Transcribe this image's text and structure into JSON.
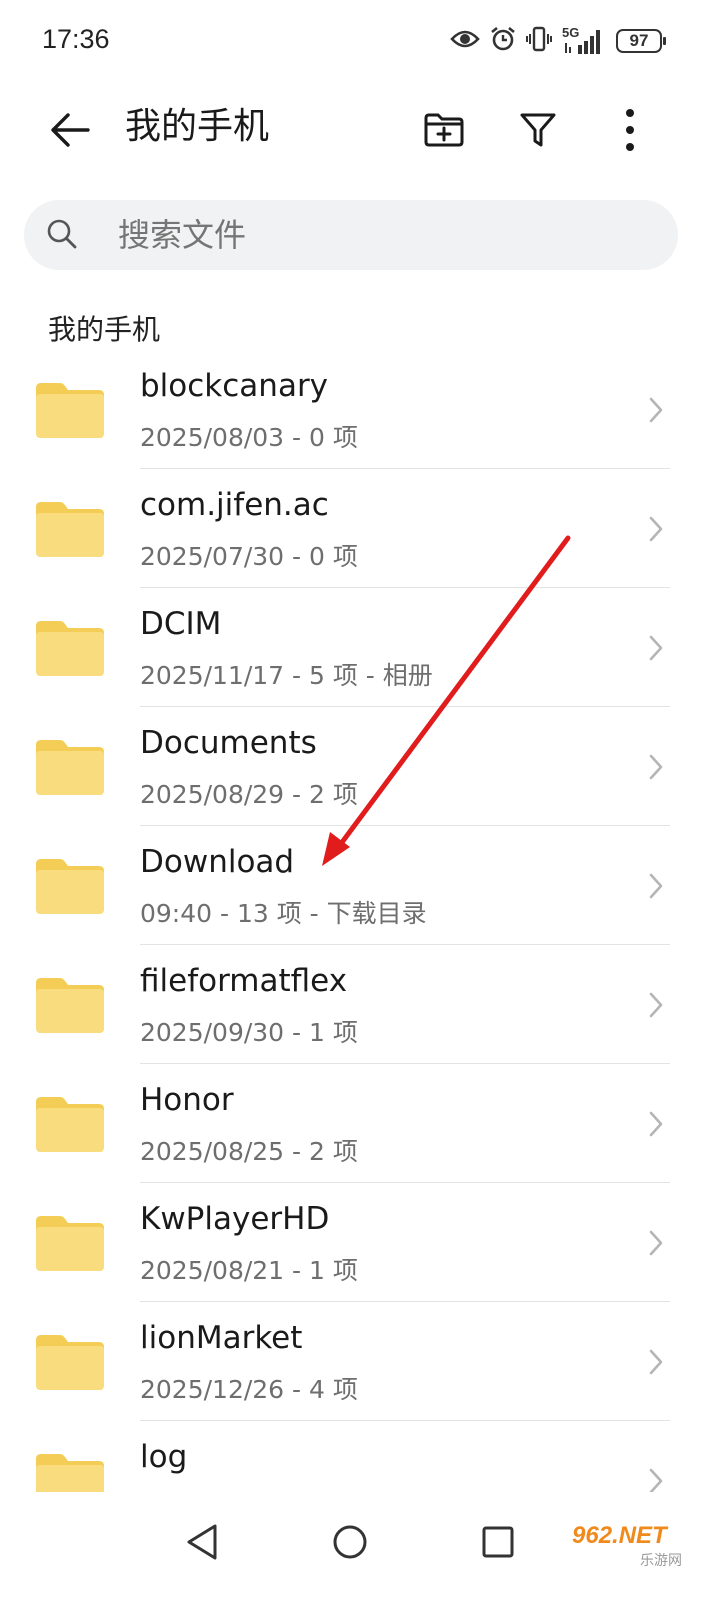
{
  "status_bar": {
    "time": "17:36",
    "network_label": "5G",
    "battery_level": "97",
    "icons": [
      "eye-icon",
      "alarm-icon",
      "vibrate-icon",
      "signal-5g-icon",
      "battery-icon"
    ]
  },
  "header": {
    "title": "我的手机",
    "back_icon": "back-arrow-icon",
    "actions": [
      "new-folder-icon",
      "filter-icon",
      "more-vert-icon"
    ]
  },
  "search": {
    "placeholder": "搜索文件"
  },
  "section": {
    "title": "我的手机"
  },
  "files": [
    {
      "name": "blockcanary",
      "meta": "2025/08/03 - 0 项"
    },
    {
      "name": "com.jifen.ac",
      "meta": "2025/07/30 - 0 项"
    },
    {
      "name": "DCIM",
      "meta": "2025/11/17 - 5 项 - 相册"
    },
    {
      "name": "Documents",
      "meta": "2025/08/29 - 2 项"
    },
    {
      "name": "Download",
      "meta": "09:40 - 13 项 - 下载目录"
    },
    {
      "name": "fileformatflex",
      "meta": "2025/09/30 - 1 项"
    },
    {
      "name": "Honor",
      "meta": "2025/08/25 - 2 项"
    },
    {
      "name": "KwPlayerHD",
      "meta": "2025/08/21 - 1 项"
    },
    {
      "name": "lionMarket",
      "meta": "2025/12/26 - 4 项"
    },
    {
      "name": "log",
      "meta": ""
    }
  ],
  "nav": {
    "buttons": [
      "back-triangle-icon",
      "home-circle-icon",
      "recents-square-icon"
    ]
  },
  "watermark": {
    "line1": "962.NET",
    "line2": "乐游网"
  },
  "colors": {
    "folder": "#f7d66b",
    "annotation_arrow": "#e11c1c",
    "search_bg": "#f1f2f3"
  }
}
